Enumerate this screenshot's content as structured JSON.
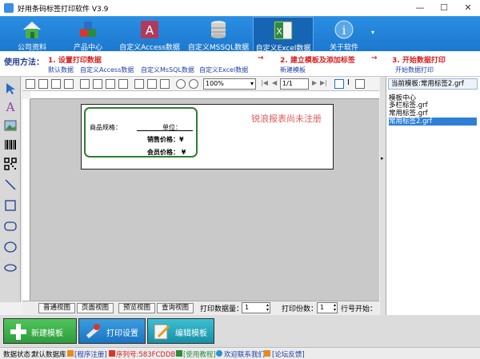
{
  "window": {
    "title": "好用条码标签打印软件 V3.9",
    "minimize": "—",
    "maximize": "☐",
    "close": "✕"
  },
  "toolbar": {
    "items": [
      {
        "label": "公司资料"
      },
      {
        "label": "产品中心"
      },
      {
        "label": "自定义Access数据"
      },
      {
        "label": "自定义MSSQL数据"
      },
      {
        "label": "自定义Excel数据"
      },
      {
        "label": "关于软件"
      }
    ],
    "overflow": "▾"
  },
  "usage": {
    "heading": "使用方法：",
    "step1": "1. 设置打印数据",
    "step1_links": [
      "默认数据",
      "自定义Access数据",
      "自定义MsSQL数据",
      "自定义Excel数据"
    ],
    "step2": "2. 建立模板及添加标签",
    "step2_link": "新建模板",
    "step3": "3. 开始数据打印",
    "step3_link": "开始数据打印",
    "arrow": "→"
  },
  "designer": {
    "zoom": "100%",
    "page": "1/1",
    "watermark": "锐浪报表尚未注册",
    "label": {
      "spec_label": "商品规格：",
      "unit_label": "单位：",
      "sale_price_label": "销售价格：¥",
      "member_price_label": "会员价格：  ¥"
    }
  },
  "bottom": {
    "tabs": [
      "普通视图",
      "页面视图",
      "预览视图",
      "查询视图"
    ],
    "print_qty_label": "打印数据量：",
    "print_qty_value": "1",
    "copies_label": "打印份数：",
    "copies_value": "1",
    "row_start_label": "行号开始："
  },
  "right_panel": {
    "current_template": "当前模板:常用标签2.grf",
    "center_title": "模板中心",
    "templates": [
      "多栏标签.grf",
      "常用标签.grf",
      "常用标签2.grf"
    ],
    "selected_index": 2
  },
  "actions": {
    "new_template": "新建模板",
    "print_settings": "打印设置",
    "edit_template": "编辑模板"
  },
  "status": {
    "db_state_label": "数据状态：",
    "db_state_value": "默认数据库",
    "register": "[程序注册]",
    "serial": "序列号:583FCDDB...",
    "tutorial": "[使用教程]",
    "contact": "欢迎联系我们",
    "forum": "[论坛反馈]"
  },
  "colors": {
    "toolbar_blue": "#1f82d6",
    "label_frame_green": "#2f7d32",
    "watermark_red": "#e35a5a",
    "new_btn_green": "#3ab54a",
    "print_btn_blue": "#1f84cf",
    "edit_btn_teal": "#1aa3b8",
    "selected_blue": "#2f7fd6"
  }
}
